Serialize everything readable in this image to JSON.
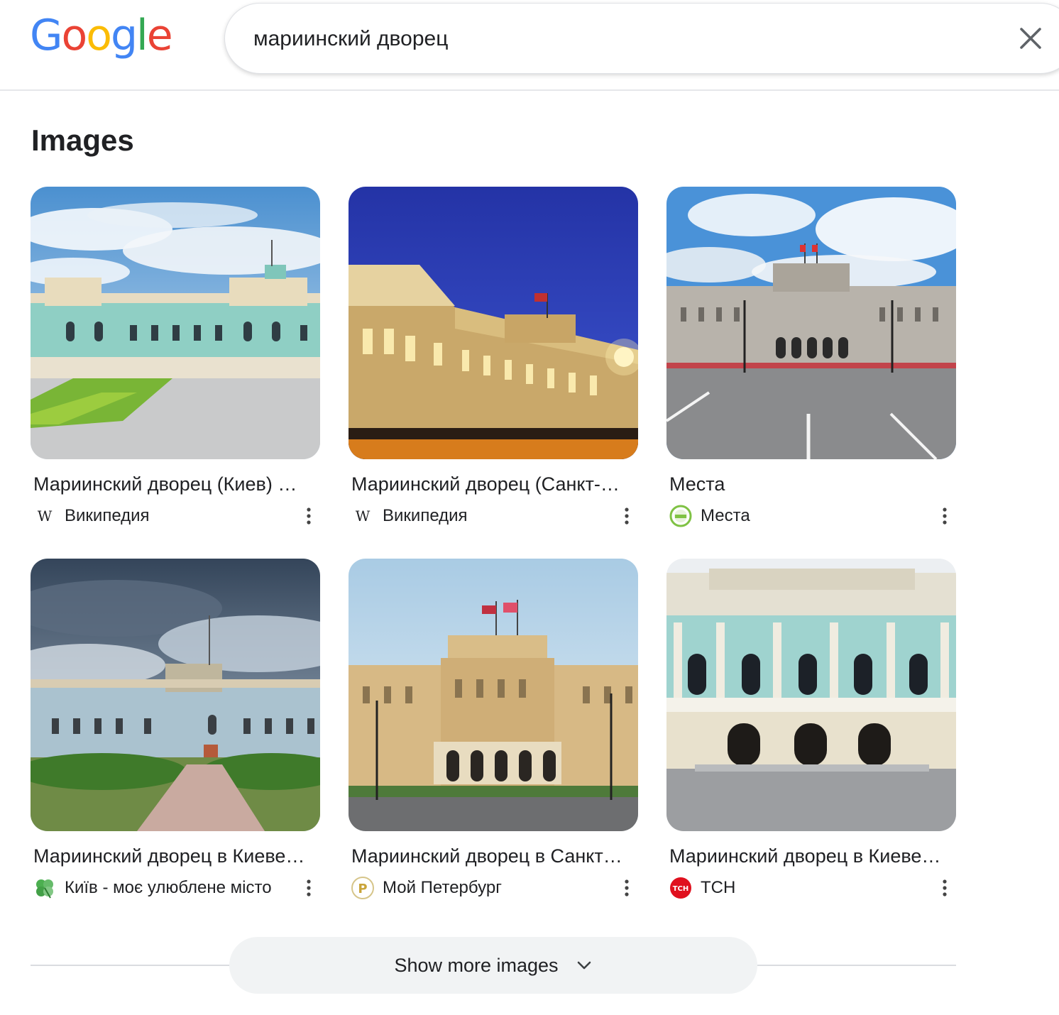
{
  "logo": {
    "letters": [
      {
        "ch": "G",
        "color": "#4285F4"
      },
      {
        "ch": "o",
        "color": "#EA4335"
      },
      {
        "ch": "o",
        "color": "#FBBC05"
      },
      {
        "ch": "g",
        "color": "#4285F4"
      },
      {
        "ch": "l",
        "color": "#34A853"
      },
      {
        "ch": "e",
        "color": "#EA4335"
      }
    ]
  },
  "search": {
    "query": "мариинский дворец"
  },
  "section": {
    "title": "Images"
  },
  "results": [
    {
      "title": "Мариинский дворец (Киев) …",
      "source": "Википедия",
      "favicon": "wikipedia-icon"
    },
    {
      "title": "Мариинский дворец (Санкт-…",
      "source": "Википедия",
      "favicon": "wikipedia-icon"
    },
    {
      "title": "Места",
      "source": "Места",
      "favicon": "mesta-icon"
    },
    {
      "title": "Мариинский дворец в Киеве…",
      "source": "Київ - моє улюблене місто",
      "favicon": "clover-icon"
    },
    {
      "title": "Мариинский дворец в Санкт…",
      "source": "Мой Петербург",
      "favicon": "moy-peterburg-icon"
    },
    {
      "title": "Мариинский дворец в Киеве…",
      "source": "ТСН",
      "favicon": "tsn-icon"
    }
  ],
  "show_more": {
    "label": "Show more images"
  }
}
